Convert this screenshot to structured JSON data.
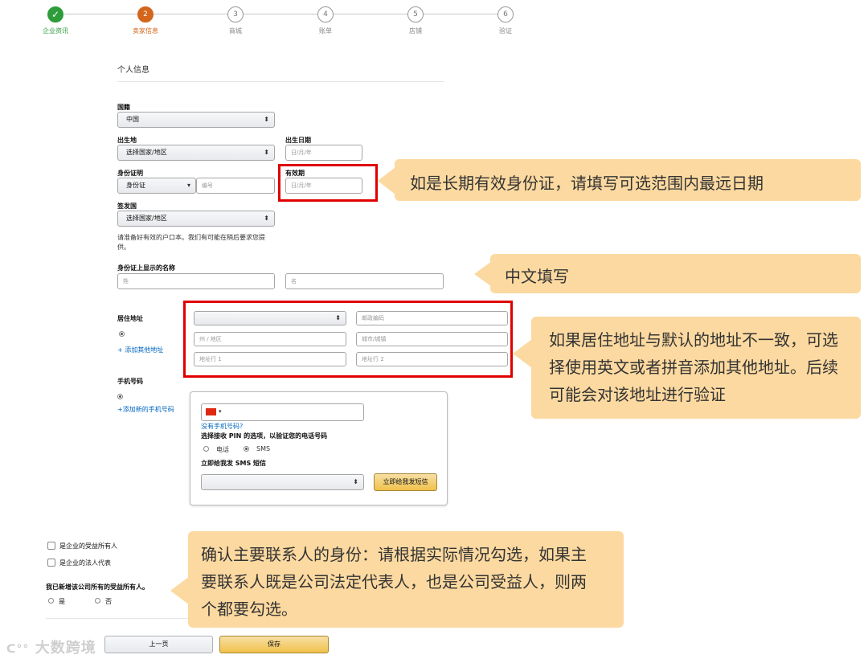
{
  "stepper": {
    "steps": [
      {
        "num": "✓",
        "label": "企业资讯",
        "state": "done"
      },
      {
        "num": "2",
        "label": "卖家信息",
        "state": "active"
      },
      {
        "num": "3",
        "label": "商城",
        "state": "pending"
      },
      {
        "num": "4",
        "label": "账单",
        "state": "pending"
      },
      {
        "num": "5",
        "label": "店铺",
        "state": "pending"
      },
      {
        "num": "6",
        "label": "验证",
        "state": "pending"
      }
    ]
  },
  "section_title": "个人信息",
  "country": {
    "label": "国籍",
    "value": "中国"
  },
  "birthplace": {
    "label": "出生地",
    "value": "选择国家/地区"
  },
  "birthdate": {
    "label": "出生日期",
    "placeholder": "日/月/年"
  },
  "id_doc": {
    "label": "身份证明",
    "type_value": "身份证",
    "number_placeholder": "编号"
  },
  "expiry": {
    "label": "有效期",
    "placeholder": "日/月/年"
  },
  "issuing_country": {
    "label": "签发国",
    "value": "选择国家/地区"
  },
  "hukou_note": "请准备好有效的户口本。我们有可能在稍后要求您提供。",
  "name_on_id": {
    "label": "身份证上显示的名称",
    "surname_placeholder": "姓",
    "given_placeholder": "名"
  },
  "address": {
    "label": "居住地址",
    "add_link": "+ 添加其他地址",
    "country_value": "",
    "postal_placeholder": "邮政编码",
    "state_placeholder": "州 / 地区",
    "city_placeholder": "城市/城镇",
    "line1_placeholder": "地址行 1",
    "line2_placeholder": "地址行 2"
  },
  "phone": {
    "label": "手机号码",
    "add_link": "+添加新的手机号码",
    "no_phone_link": "没有手机号码?",
    "pin_label": "选择接收 PIN 的选项，以验证您的电话号码",
    "option_call": "电话",
    "option_sms": "SMS",
    "send_label": "立即给我发 SMS 短信",
    "language_value": "",
    "send_button": "立即给我发短信"
  },
  "roles": {
    "beneficial_owner": "是企业的受益所有人",
    "legal_rep": "是企业的法人代表",
    "question": "我已新增该公司所有的受益所有人。",
    "yes": "是",
    "no": "否"
  },
  "buttons": {
    "prev": "上一页",
    "save": "保存"
  },
  "callouts": {
    "expiry": "如是长期有效身份证，请填写可选范围内最远日期",
    "name": "中文填写",
    "address": "如果居住地址与默认的地址不一致，可选择使用英文或者拼音添加其他地址。后续可能会对该地址进行验证",
    "roles": "确认主要联系人的身份：请根据实际情况勾选，如果主要联系人既是公司法定代表人，也是公司受益人，则两个都要勾选。"
  },
  "watermark": "大数跨境",
  "colors": {
    "done": "#2e9c3a",
    "active": "#d3661b",
    "highlight": "#e00000",
    "callout": "#fcd9a0",
    "link": "#0066c0"
  }
}
